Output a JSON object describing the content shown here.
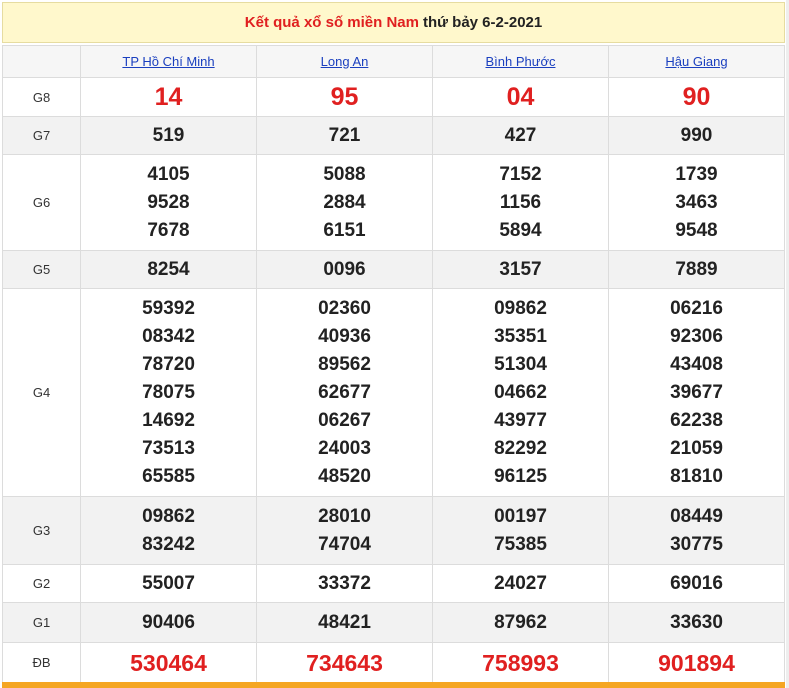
{
  "title": {
    "part1": "Kết quả xổ số miền Nam",
    "part2": "thứ bảy 6-2-2021"
  },
  "provinces": [
    "TP Hồ Chí Minh",
    "Long An",
    "Bình Phước",
    "Hậu Giang"
  ],
  "prizes": [
    {
      "label": "G8",
      "style": "big",
      "values": [
        [
          "14"
        ],
        [
          "95"
        ],
        [
          "04"
        ],
        [
          "90"
        ]
      ]
    },
    {
      "label": "G7",
      "style": "normal",
      "values": [
        [
          "519"
        ],
        [
          "721"
        ],
        [
          "427"
        ],
        [
          "990"
        ]
      ]
    },
    {
      "label": "G6",
      "style": "normal",
      "values": [
        [
          "4105",
          "9528",
          "7678"
        ],
        [
          "5088",
          "2884",
          "6151"
        ],
        [
          "7152",
          "1156",
          "5894"
        ],
        [
          "1739",
          "3463",
          "9548"
        ]
      ]
    },
    {
      "label": "G5",
      "style": "normal",
      "values": [
        [
          "8254"
        ],
        [
          "0096"
        ],
        [
          "3157"
        ],
        [
          "7889"
        ]
      ]
    },
    {
      "label": "G4",
      "style": "normal",
      "values": [
        [
          "59392",
          "08342",
          "78720",
          "78075",
          "14692",
          "73513",
          "65585"
        ],
        [
          "02360",
          "40936",
          "89562",
          "62677",
          "06267",
          "24003",
          "48520"
        ],
        [
          "09862",
          "35351",
          "51304",
          "04662",
          "43977",
          "82292",
          "96125"
        ],
        [
          "06216",
          "92306",
          "43408",
          "39677",
          "62238",
          "21059",
          "81810"
        ]
      ]
    },
    {
      "label": "G3",
      "style": "normal",
      "values": [
        [
          "09862",
          "83242"
        ],
        [
          "28010",
          "74704"
        ],
        [
          "00197",
          "75385"
        ],
        [
          "08449",
          "30775"
        ]
      ]
    },
    {
      "label": "G2",
      "style": "normal",
      "values": [
        [
          "55007"
        ],
        [
          "33372"
        ],
        [
          "24027"
        ],
        [
          "69016"
        ]
      ]
    },
    {
      "label": "G1",
      "style": "normal",
      "values": [
        [
          "90406"
        ],
        [
          "48421"
        ],
        [
          "87962"
        ],
        [
          "33630"
        ]
      ]
    },
    {
      "label": "ĐB",
      "style": "db",
      "values": [
        [
          "530464"
        ],
        [
          "734643"
        ],
        [
          "758993"
        ],
        [
          "901894"
        ]
      ]
    }
  ],
  "colors": {
    "accent_red": "#e02020",
    "link_blue": "#1a3fbf",
    "title_bg": "#fff8cc",
    "bottom_bar": "#f5a623"
  }
}
